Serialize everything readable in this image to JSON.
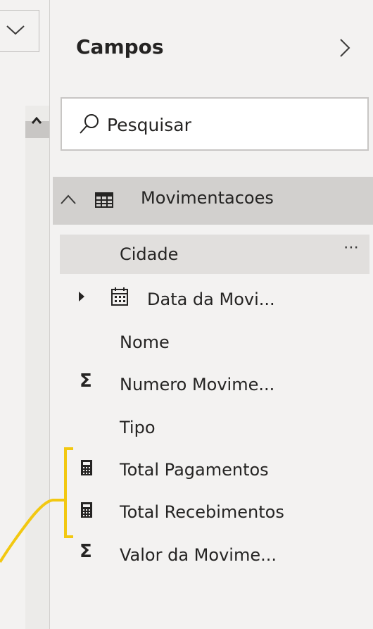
{
  "panel": {
    "title": "Campos",
    "collapse_icon": "chevron-right-icon"
  },
  "left_panel": {
    "dropdown_icon": "chevron-down-icon",
    "scroll_up_icon": "caret-up-icon"
  },
  "search": {
    "placeholder": "Pesquisar",
    "icon": "search-icon"
  },
  "table": {
    "name": "Movimentacoes",
    "expanded": true,
    "icon": "table-icon",
    "fields": [
      {
        "label": "Cidade",
        "icon": "",
        "selected": true,
        "more": "⋯"
      },
      {
        "label": "Data da Movi...",
        "icon": "calendar-icon",
        "expandable": true
      },
      {
        "label": "Nome",
        "icon": ""
      },
      {
        "label": "Numero Movime...",
        "icon": "sigma-icon"
      },
      {
        "label": "Tipo",
        "icon": ""
      },
      {
        "label": "Total Pagamentos",
        "icon": "calculator-icon"
      },
      {
        "label": "Total Recebimentos",
        "icon": "calculator-icon"
      },
      {
        "label": "Valor da Movime...",
        "icon": "sigma-icon"
      }
    ]
  },
  "annotation": {
    "bracket_color": "#f2c811"
  }
}
